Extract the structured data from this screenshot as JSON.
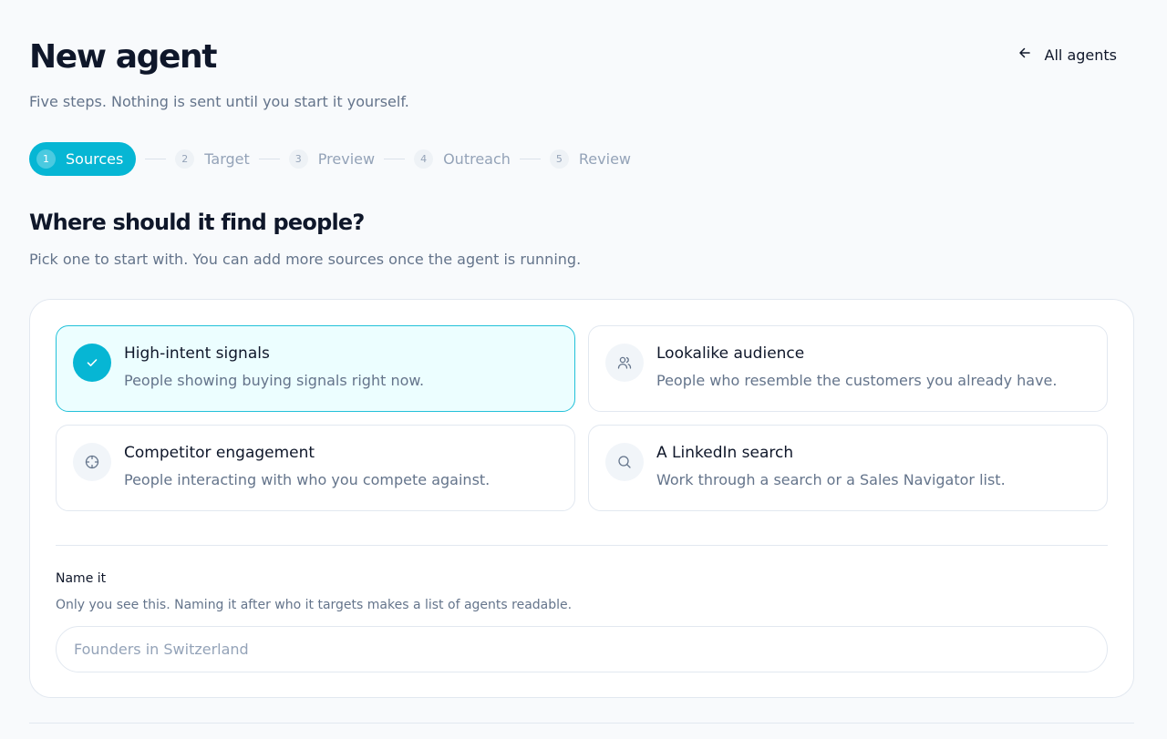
{
  "header": {
    "title": "New agent",
    "back_label": "All agents",
    "subtitle": "Five steps. Nothing is sent until you start it yourself."
  },
  "stepper": {
    "active_index": 0,
    "steps": [
      {
        "num": "1",
        "label": "Sources"
      },
      {
        "num": "2",
        "label": "Target"
      },
      {
        "num": "3",
        "label": "Preview"
      },
      {
        "num": "4",
        "label": "Outreach"
      },
      {
        "num": "5",
        "label": "Review"
      }
    ]
  },
  "section": {
    "title": "Where should it find people?",
    "description": "Pick one to start with. You can add more sources once the agent is running."
  },
  "sources": [
    {
      "icon": "check-icon",
      "title": "High-intent signals",
      "description": "People showing buying signals right now.",
      "selected": true
    },
    {
      "icon": "users-icon",
      "title": "Lookalike audience",
      "description": "People who resemble the customers you already have.",
      "selected": false
    },
    {
      "icon": "crosshair-icon",
      "title": "Competitor engagement",
      "description": "People interacting with who you compete against.",
      "selected": false
    },
    {
      "icon": "search-icon",
      "title": "A LinkedIn search",
      "description": "Work through a search or a Sales Navigator list.",
      "selected": false
    }
  ],
  "name_field": {
    "label": "Name it",
    "help": "Only you see this. Naming it after who it targets makes a list of agents readable.",
    "placeholder": "Founders in Switzerland",
    "value": ""
  },
  "colors": {
    "accent": "#06b6d4",
    "selected_bg": "#ecfeff",
    "text": "#0f172a",
    "muted": "#64748b"
  }
}
